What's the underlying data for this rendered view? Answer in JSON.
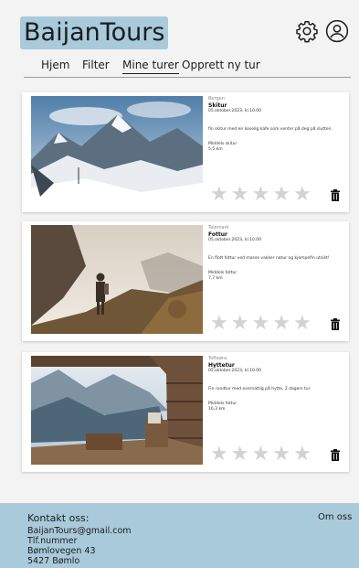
{
  "app": {
    "logo_text": "BaijanTours"
  },
  "icons": {
    "settings": "gear-icon",
    "profile": "user-icon",
    "delete": "trash-icon",
    "rating": "star-icon"
  },
  "colors": {
    "accent": "#a9cadb",
    "star_empty": "#d2d2d2",
    "background": "#f3f3f3"
  },
  "nav": {
    "items": [
      {
        "label": "Hjem"
      },
      {
        "label": "Filter"
      },
      {
        "label": "Mine turer"
      },
      {
        "label": "Opprett ny tur"
      }
    ],
    "active_index": 2
  },
  "trips": [
    {
      "location": "Bergen",
      "title": "Skitur",
      "date": "05.oktober.2023, kl.10.00",
      "description": "fin skitur med en koselig kafe som venter på deg på slutten.",
      "level": "Middels skitur",
      "distance": "5,5 km",
      "rating": 0,
      "rating_max": 5
    },
    {
      "location": "Telemark",
      "title": "Fottur",
      "date": "05.oktober.2023, kl.10.00",
      "description": "En flott fottur ved masse vakker natur og kjempefin utsikt!",
      "level": "Middels fottur",
      "distance": "7,7 km",
      "rating": 0,
      "rating_max": 5
    },
    {
      "location": "Tofteøra",
      "title": "Hyttetur",
      "date": "05.oktober.2023, kl.10.00",
      "description": "Fin rundtur med overnattig på hytte, 2 dagers tur.",
      "level": "Middels fottur",
      "distance": "16,3 km",
      "rating": 0,
      "rating_max": 5
    }
  ],
  "footer": {
    "title": "Kontakt oss:",
    "about_link": "Om oss",
    "email": "BaijanTours@gmail.com",
    "phone": "Tlf.nummer",
    "address": "Bømlovegen 43",
    "postal": "5427 Bømlo"
  }
}
